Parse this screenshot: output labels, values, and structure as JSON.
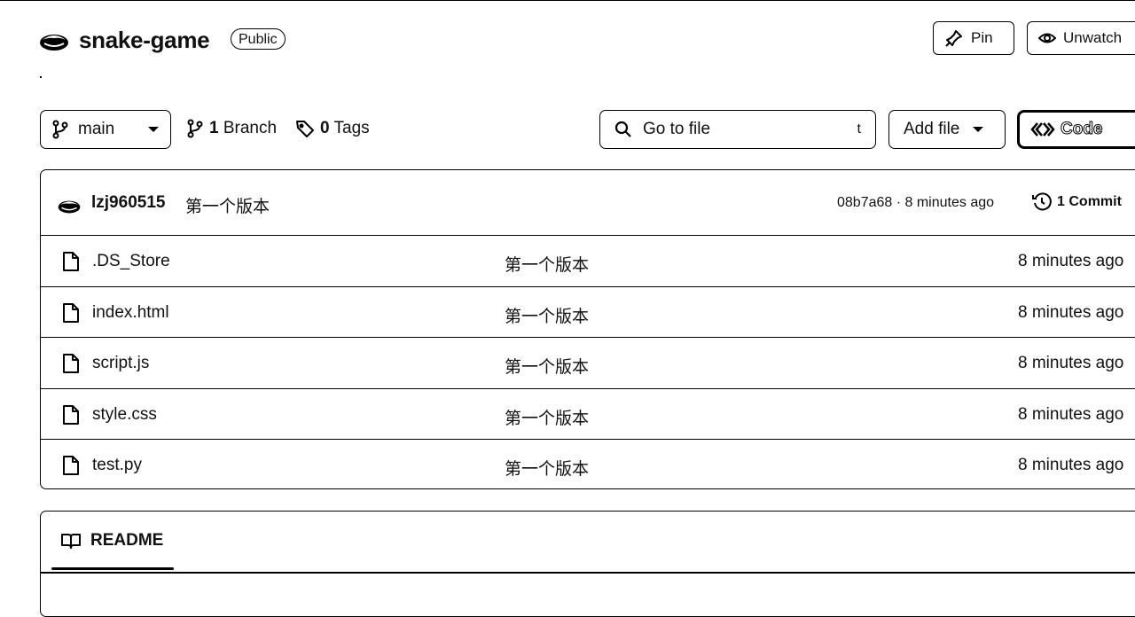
{
  "repo": {
    "name": "snake-game",
    "visibility": "Public",
    "avatar_icon": "user-avatar-icon"
  },
  "header_actions": {
    "pin_label": "Pin",
    "unwatch_label": "Unwatch"
  },
  "toolbar": {
    "branch": "main",
    "branch_count": "1",
    "branch_word": "Branch",
    "tag_count": "0",
    "tag_word": "Tags",
    "go_to_file_placeholder": "Go to file",
    "go_to_file_shortcut": "t",
    "add_file_label": "Add file",
    "code_label": "Code"
  },
  "latest_commit": {
    "author": "lzj960515",
    "message": "第一个版本",
    "meta": "08b7a68 · 8 minutes ago",
    "commit_count": "1",
    "commit_word": "Commit"
  },
  "files": [
    {
      "name": ".DS_Store",
      "message": "第一个版本",
      "time": "8 minutes ago",
      "icon": "file-icon"
    },
    {
      "name": "index.html",
      "message": "第一个版本",
      "time": "8 minutes ago",
      "icon": "file-icon"
    },
    {
      "name": "script.js",
      "message": "第一个版本",
      "time": "8 minutes ago",
      "icon": "file-icon"
    },
    {
      "name": "style.css",
      "message": "第一个版本",
      "time": "8 minutes ago",
      "icon": "file-icon"
    },
    {
      "name": "test.py",
      "message": "第一个版本",
      "time": "8 minutes ago",
      "icon": "file-icon"
    }
  ],
  "readme": {
    "tab_label": "README"
  }
}
